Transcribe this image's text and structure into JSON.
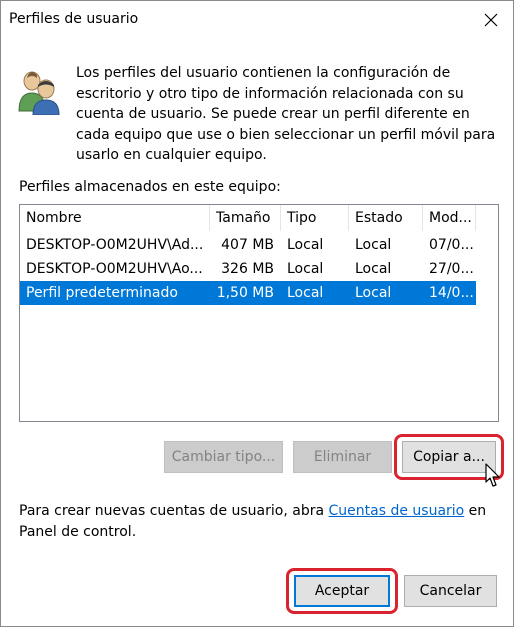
{
  "window": {
    "title": "Perfiles de usuario"
  },
  "description": "Los perfiles del usuario contienen la configuración de escritorio y otro tipo de información relacionada con su cuenta de usuario. Se puede crear un perfil diferente en cada equipo que use o bien seleccionar un perfil móvil para usarlo en cualquier equipo.",
  "stored_label": "Perfiles almacenados en este equipo:",
  "table": {
    "columns": [
      "Nombre",
      "Tamaño",
      "Tipo",
      "Estado",
      "Mod..."
    ],
    "rows": [
      [
        "DESKTOP-O0M2UHV\\Ad...",
        "407 MB",
        "Local",
        "Local",
        "07/0..."
      ],
      [
        "DESKTOP-O0M2UHV\\Ao...",
        "326 MB",
        "Local",
        "Local",
        "27/0..."
      ],
      [
        "Perfil predeterminado",
        "1,50 MB",
        "Local",
        "Local",
        "14/0..."
      ]
    ],
    "selected_row": 2
  },
  "buttons": {
    "change_type": "Cambiar tipo...",
    "delete": "Eliminar",
    "copy_to": "Copiar a...",
    "ok": "Aceptar",
    "cancel": "Cancelar"
  },
  "info": {
    "prefix": "Para crear nuevas cuentas de usuario, abra ",
    "link": "Cuentas de usuario",
    "suffix": " en Panel de control."
  },
  "colors": {
    "selection": "#0078d7",
    "highlight": "#d9232e",
    "link": "#0066cc"
  },
  "icons": {
    "app": "users-icon",
    "close": "close-icon",
    "cursor": "mouse-pointer-icon"
  }
}
